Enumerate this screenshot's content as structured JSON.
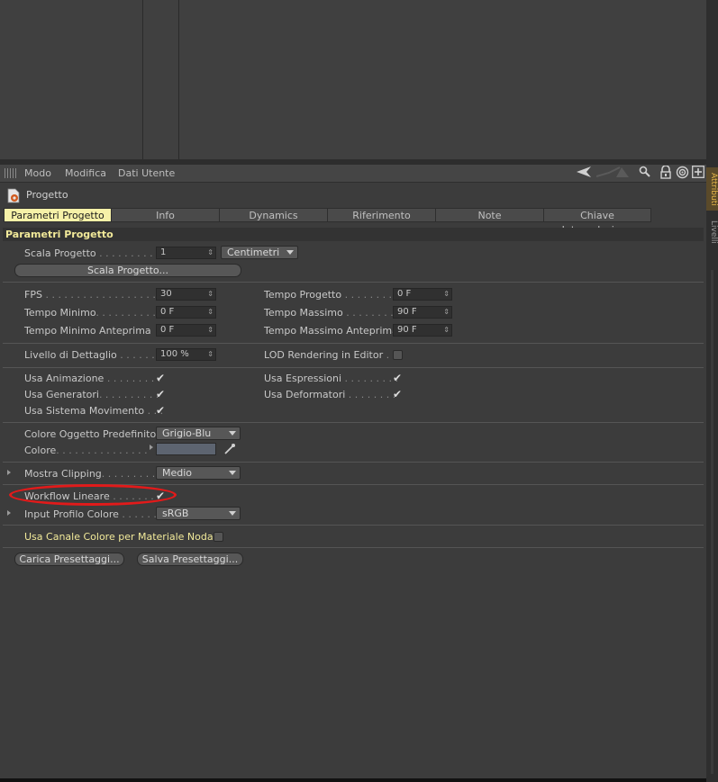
{
  "menubar": {
    "items": [
      "Modo",
      "Modifica",
      "Dati Utente"
    ],
    "icons": [
      "arrow-left-icon",
      "arrow-up-icon",
      "search-icon",
      "lock-icon",
      "target-icon",
      "add-icon"
    ]
  },
  "side_tabs": [
    "Attributi",
    "Livelli"
  ],
  "object": {
    "name": "Progetto"
  },
  "tabs": [
    {
      "label": "Parametri Progetto",
      "active": true
    },
    {
      "label": "Info"
    },
    {
      "label": "Dynamics"
    },
    {
      "label": "Riferimento"
    },
    {
      "label": "Note"
    },
    {
      "label": "Chiave Interpolazione"
    }
  ],
  "section": {
    "title": "Parametri Progetto"
  },
  "scale": {
    "label": "Scala Progetto",
    "value": "1",
    "unit": "Centimetri",
    "button": "Scala Progetto..."
  },
  "time": {
    "fps_label": "FPS",
    "fps": "30",
    "min_label": "Tempo Minimo",
    "min": "0 F",
    "min_preview_label": "Tempo Minimo Anteprima",
    "min_preview": "0 F",
    "project_label": "Tempo Progetto",
    "project": "0 F",
    "max_label": "Tempo Massimo",
    "max": "90 F",
    "max_preview_label": "Tempo Massimo Anteprima",
    "max_preview": "90 F"
  },
  "lod": {
    "label": "Livello di Dettaglio",
    "value": "100 %",
    "editor_label": "LOD Rendering in Editor"
  },
  "usage": {
    "animation": "Usa Animazione",
    "expressions": "Usa Espressioni",
    "generators": "Usa Generatori",
    "deformers": "Usa Deformatori",
    "motion": "Usa Sistema Movimento"
  },
  "color": {
    "default_label": "Colore Oggetto Predefinito",
    "default_value": "Grigio-Blu",
    "color_label": "Colore",
    "swatch": "#5d6470"
  },
  "clipping": {
    "label": "Mostra Clipping",
    "value": "Medio"
  },
  "workflow": {
    "label": "Workflow Lineare"
  },
  "profile": {
    "label": "Input Profilo Colore",
    "value": "sRGB"
  },
  "node": {
    "label": "Usa Canale Colore per Materiale Nodale"
  },
  "presets": {
    "load": "Carica Presettaggi...",
    "save": "Salva Presettaggi..."
  },
  "colors": {
    "accent": "#f6f1a8",
    "highlight": "#e21a1a",
    "swatch_tab": "#d9a441"
  }
}
